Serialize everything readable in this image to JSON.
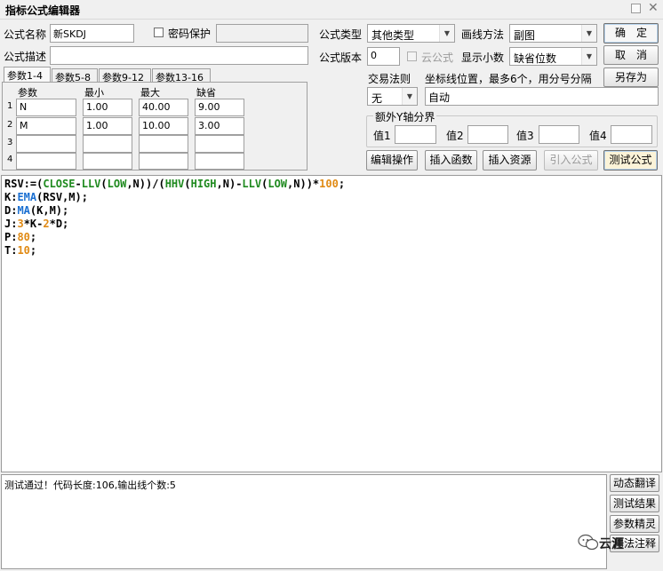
{
  "window": {
    "title": "指标公式编辑器"
  },
  "form": {
    "name_label": "公式名称",
    "name_value": "新SKDJ",
    "password_label": "密码保护",
    "desc_label": "公式描述",
    "desc_value": "",
    "type_label": "公式类型",
    "type_value": "其他类型",
    "draw_label": "画线方法",
    "draw_value": "副图",
    "version_label": "公式版本",
    "version_value": "0",
    "cloud_label": "云公式",
    "decimals_label": "显示小数",
    "decimals_value": "缺省位数",
    "trade_label": "交易法则",
    "trade_value": "无",
    "coord_label": "坐标线位置，最多6个，用分号分隔",
    "coord_value": "自动",
    "yaxis_group_label": "额外Y轴分界",
    "yaxis_values": [
      {
        "label": "值1",
        "value": ""
      },
      {
        "label": "值2",
        "value": ""
      },
      {
        "label": "值3",
        "value": ""
      },
      {
        "label": "值4",
        "value": ""
      }
    ]
  },
  "side_buttons": {
    "ok": "确　定",
    "cancel": "取　消",
    "save_as": "另存为"
  },
  "params": {
    "tabs": [
      "参数1-4",
      "参数5-8",
      "参数9-12",
      "参数13-16"
    ],
    "headers": [
      "参数",
      "最小",
      "最大",
      "缺省"
    ],
    "rows": [
      {
        "index": "1",
        "name": "N",
        "min": "1.00",
        "max": "40.00",
        "default": "9.00"
      },
      {
        "index": "2",
        "name": "M",
        "min": "1.00",
        "max": "10.00",
        "default": "3.00"
      },
      {
        "index": "3",
        "name": "",
        "min": "",
        "max": "",
        "default": ""
      },
      {
        "index": "4",
        "name": "",
        "min": "",
        "max": "",
        "default": ""
      }
    ]
  },
  "toolbar": {
    "edit_ops": "编辑操作",
    "insert_func": "插入函数",
    "insert_resource": "插入资源",
    "import_formula": "引入公式",
    "test_formula": "测试公式"
  },
  "code": {
    "lines": [
      [
        [
          "RSV:=(",
          "op"
        ],
        [
          "CLOSE",
          "fn"
        ],
        [
          "-",
          "op"
        ],
        [
          "LLV",
          "fn"
        ],
        [
          "(",
          "op"
        ],
        [
          "LOW",
          "fn"
        ],
        [
          ",N))/(",
          "op"
        ],
        [
          "HHV",
          "fn"
        ],
        [
          "(",
          "op"
        ],
        [
          "HIGH",
          "fn"
        ],
        [
          ",N)-",
          "op"
        ],
        [
          "LLV",
          "fn"
        ],
        [
          "(",
          "op"
        ],
        [
          "LOW",
          "fn"
        ],
        [
          ",N))*",
          "op"
        ],
        [
          "100",
          "num"
        ],
        [
          ";",
          "op"
        ]
      ],
      [
        [
          "K:",
          "op"
        ],
        [
          "EMA",
          "fn2"
        ],
        [
          "(RSV,M);",
          "op"
        ]
      ],
      [
        [
          "D:",
          "op"
        ],
        [
          "MA",
          "fn2"
        ],
        [
          "(K,M);",
          "op"
        ]
      ],
      [
        [
          "J:",
          "op"
        ],
        [
          "3",
          "num"
        ],
        [
          "*K-",
          "op"
        ],
        [
          "2",
          "num"
        ],
        [
          "*D;",
          "op"
        ]
      ],
      [
        [
          "P:",
          "op"
        ],
        [
          "80",
          "num"
        ],
        [
          ";",
          "op"
        ]
      ],
      [
        [
          "T:",
          "op"
        ],
        [
          "10",
          "num"
        ],
        [
          ";",
          "op"
        ]
      ]
    ]
  },
  "output": {
    "message": "测试通过！代码长度:106,输出线个数:5"
  },
  "bottom_buttons": {
    "dynamic_translate": "动态翻译",
    "test_result": "测试结果",
    "param_wizard": "参数精灵",
    "usage_notes": "用法注释"
  },
  "watermark": {
    "text": "云涯"
  }
}
